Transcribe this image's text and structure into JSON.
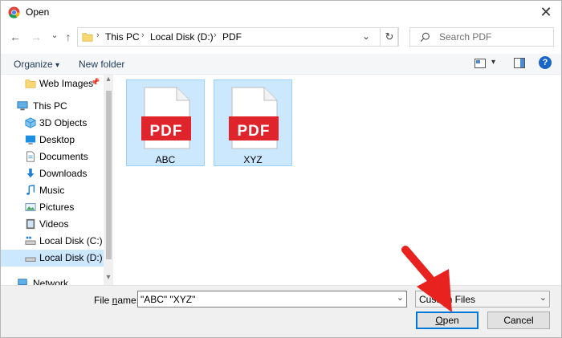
{
  "window": {
    "title": "Open",
    "close_glyph": "✕"
  },
  "nav": {
    "back_glyph": "←",
    "forward_glyph": "→",
    "recent_glyph": "⌄",
    "up_glyph": "↑",
    "breadcrumb": [
      "This PC",
      "Local Disk (D:)",
      "PDF"
    ],
    "sep_glyph": "›",
    "dropdown_glyph": "⌄",
    "refresh_glyph": "↻",
    "search_placeholder": "Search PDF"
  },
  "toolbar": {
    "organize": "Organize",
    "organize_glyph": "▾",
    "new_folder": "New folder",
    "view_glyph": "▾",
    "help_glyph": "?"
  },
  "sidebar": {
    "items": [
      {
        "label": "Web Images",
        "icon": "folder-icon",
        "pin": "📌"
      },
      {
        "label": "This PC",
        "icon": "computer-icon"
      },
      {
        "label": "3D Objects",
        "icon": "cube-icon"
      },
      {
        "label": "Desktop",
        "icon": "desktop-icon"
      },
      {
        "label": "Documents",
        "icon": "documents-icon"
      },
      {
        "label": "Downloads",
        "icon": "download-icon"
      },
      {
        "label": "Music",
        "icon": "music-icon"
      },
      {
        "label": "Pictures",
        "icon": "pictures-icon"
      },
      {
        "label": "Videos",
        "icon": "videos-icon"
      },
      {
        "label": "Local Disk (C:)",
        "icon": "drive-icon"
      },
      {
        "label": "Local Disk (D:)",
        "icon": "drive-icon"
      },
      {
        "label": "Network",
        "icon": "network-icon"
      }
    ],
    "scroll_up_glyph": "▴",
    "scroll_down_glyph": "▾"
  },
  "files": [
    {
      "name": "ABC",
      "badge": "PDF"
    },
    {
      "name": "XYZ",
      "badge": "PDF"
    }
  ],
  "bottom": {
    "filename_label_prefix": "File ",
    "filename_label_access": "n",
    "filename_label_rest": "ame:",
    "filename_value": "\"ABC\" \"XYZ\"",
    "filename_dropdown_glyph": "⌄",
    "filetype_value": "Custom Files",
    "filetype_dropdown_glyph": "⌄",
    "open_access": "O",
    "open_rest": "pen",
    "cancel": "Cancel"
  },
  "colors": {
    "pdf_red": "#e0242b",
    "arrow_red": "#e8231f",
    "selection": "#cce8ff",
    "accent": "#0078d7"
  }
}
